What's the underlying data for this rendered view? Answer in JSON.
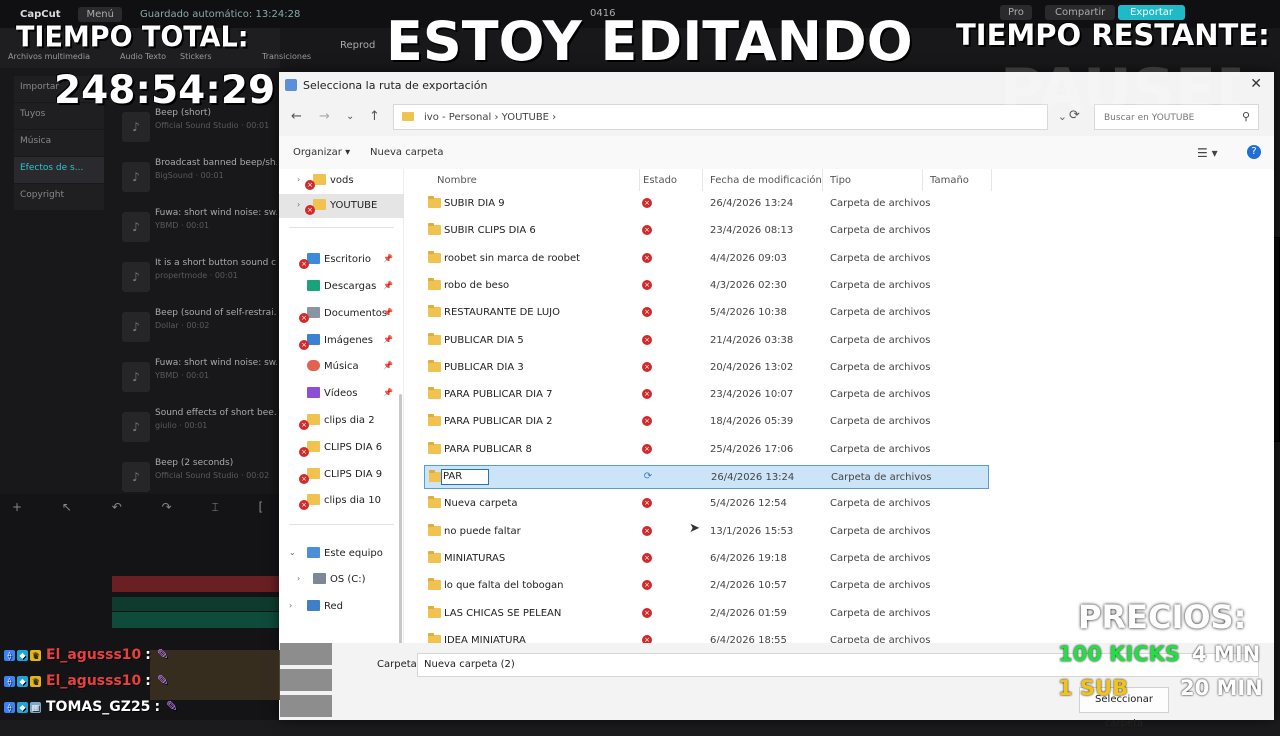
{
  "capcut": {
    "logo": "CapCut",
    "menu": "Menú",
    "autosave": "Guardado automático: 13:24:28",
    "project": "0416",
    "pro": "Pro",
    "share": "Compartir",
    "export": "Exportar",
    "tools": [
      "Archivos multimedia",
      "Audio",
      "Texto",
      "Stickers",
      "Transiciones"
    ],
    "player": "Reprod",
    "side": [
      "Importar",
      "Tuyos",
      "Música",
      "Efectos de s...",
      "Copyright"
    ],
    "sounds": [
      {
        "title": "Beep (short)",
        "sub": "Official Sound Studio · 00:01"
      },
      {
        "title": "Broadcast banned beep/sh...",
        "sub": "BigSound · 00:01"
      },
      {
        "title": "Fuwa: short wind noise: sw...",
        "sub": "YBMD · 00:01"
      },
      {
        "title": "It is a short button sound c...",
        "sub": "propertmode · 00:01"
      },
      {
        "title": "Beep (sound of self-restrai...",
        "sub": "Dollar · 00:02"
      },
      {
        "title": "Fuwa: short wind noise: sw...",
        "sub": "YBMD · 00:01"
      },
      {
        "title": "Sound effects of short bee...",
        "sub": "giulio · 00:01"
      },
      {
        "title": "Beep (2 seconds)",
        "sub": "Official Sound Studio · 00:02"
      }
    ]
  },
  "overlay": {
    "title": "ESTOY EDITANDO",
    "total_label": "TIEMPO TOTAL:",
    "total_value": "248:54:29",
    "remaining_label": "TIEMPO RESTANTE:",
    "ghost": "PAUSED",
    "prices_label": "PRECIOS:",
    "price1_item": "100 KICKS",
    "price1_value": "4 MIN",
    "price2_item": "1 SUB",
    "price2_value": "20 MIN"
  },
  "chat": [
    {
      "user": "El_agusss10",
      "color": "#e84040",
      "sep": ":"
    },
    {
      "user": "El_agusss10",
      "color": "#e84040",
      "sep": ":"
    },
    {
      "user": "TOMAS_GZ25",
      "color": "#ffffff",
      "sep": ":"
    }
  ],
  "dialog": {
    "title": "Selecciona la ruta de exportación",
    "close": "✕",
    "path": "ivo - Personal  ›  YOUTUBE  ›",
    "search_placeholder": "Buscar en YOUTUBE",
    "organize": "Organizar ▾",
    "new_folder": "Nueva carpeta",
    "nav": {
      "vods": "vods",
      "youtube": "YOUTUBE",
      "escritorio": "Escritorio",
      "descargas": "Descargas",
      "documentos": "Documentos",
      "imagenes": "Imágenes",
      "musica": "Música",
      "videos": "Vídeos",
      "clips2": "clips dia 2",
      "clips6": "CLIPS DIA 6",
      "clips9": "CLIPS DIA 9",
      "clips10": "clips dia 10",
      "equipo": "Este equipo",
      "os": "OS (C:)",
      "red": "Red"
    },
    "columns": {
      "name": "Nombre",
      "status": "Estado",
      "date": "Fecha de modificación",
      "type": "Tipo",
      "size": "Tamaño"
    },
    "rows": [
      {
        "name": "SUBIR DIA 9",
        "date": "26/4/2026 13:24",
        "type": "Carpeta de archivos"
      },
      {
        "name": "SUBIR CLIPS DIA 6",
        "date": "23/4/2026 08:13",
        "type": "Carpeta de archivos"
      },
      {
        "name": "roobet sin marca de roobet",
        "date": "4/4/2026 09:03",
        "type": "Carpeta de archivos"
      },
      {
        "name": "robo de beso",
        "date": "4/3/2026 02:30",
        "type": "Carpeta de archivos"
      },
      {
        "name": "RESTAURANTE DE LUJO",
        "date": "5/4/2026 10:38",
        "type": "Carpeta de archivos"
      },
      {
        "name": "PUBLICAR DIA 5",
        "date": "21/4/2026 03:38",
        "type": "Carpeta de archivos"
      },
      {
        "name": "PUBLICAR DIA 3",
        "date": "20/4/2026 13:02",
        "type": "Carpeta de archivos"
      },
      {
        "name": "PARA PUBLICAR DIA 7",
        "date": "23/4/2026 10:07",
        "type": "Carpeta de archivos"
      },
      {
        "name": "PARA PUBLICAR DIA 2",
        "date": "18/4/2026 05:39",
        "type": "Carpeta de archivos"
      },
      {
        "name": "PARA PUBLICAR 8",
        "date": "25/4/2026 17:06",
        "type": "Carpeta de archivos"
      },
      {
        "name": "PAR",
        "date": "26/4/2026 13:24",
        "type": "Carpeta de archivos"
      },
      {
        "name": "Nueva carpeta",
        "date": "5/4/2026 12:54",
        "type": "Carpeta de archivos"
      },
      {
        "name": "no puede faltar",
        "date": "13/1/2026 15:53",
        "type": "Carpeta de archivos"
      },
      {
        "name": "MINIATURAS",
        "date": "6/4/2026 19:18",
        "type": "Carpeta de archivos"
      },
      {
        "name": "lo que falta del tobogan",
        "date": "2/4/2026 10:57",
        "type": "Carpeta de archivos"
      },
      {
        "name": "LAS CHICAS SE PELEAN",
        "date": "2/4/2026 01:59",
        "type": "Carpeta de archivos"
      },
      {
        "name": "IDEA MINIATURA",
        "date": "6/4/2026 18:55",
        "type": "Carpeta de archivos"
      }
    ],
    "folder_label": "Carpeta:",
    "folder_value": "Nueva carpeta (2)",
    "select_button": "Seleccionar carpeta"
  }
}
